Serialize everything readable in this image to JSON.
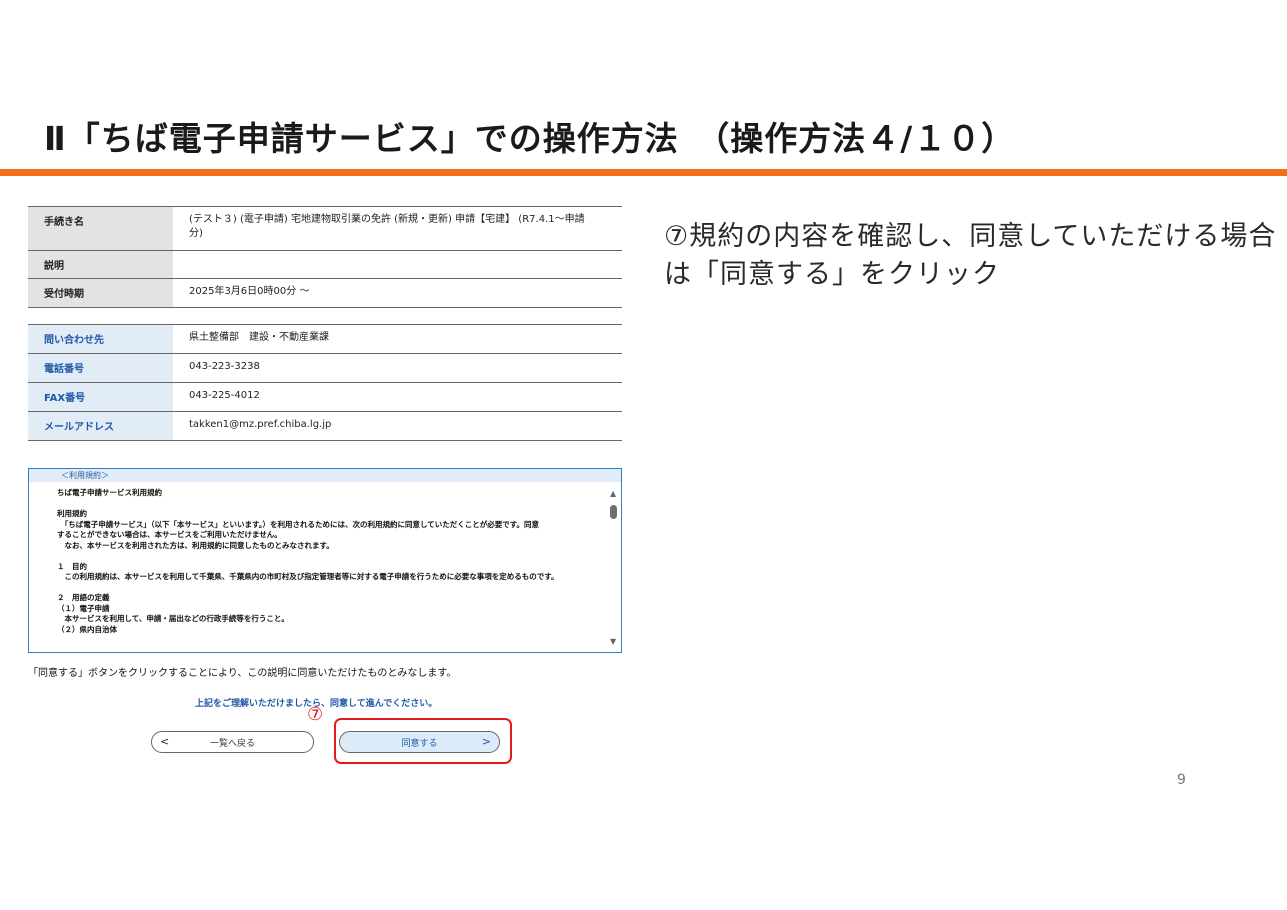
{
  "slide": {
    "title": "Ⅱ「ちば電子申請サービス」での操作方法　（操作方法４/１０）",
    "page_number": "9",
    "accent_color": "#f36f1d"
  },
  "procedure_table": {
    "rows": [
      {
        "label": "手続き名",
        "value": "(テスト３) (電子申請) 宅地建物取引業の免許 (新規・更新) 申請【宅建】 (R7.4.1～申請\n分)"
      },
      {
        "label": "説明",
        "value": ""
      },
      {
        "label": "受付時期",
        "value": "2025年3月6日0時00分 ～"
      }
    ]
  },
  "contact_table": {
    "rows": [
      {
        "label": "問い合わせ先",
        "value": "県土整備部　建設・不動産業課"
      },
      {
        "label": "電話番号",
        "value": "043-223-3238"
      },
      {
        "label": "FAX番号",
        "value": "043-225-4012"
      },
      {
        "label": "メールアドレス",
        "value": "takken1@mz.pref.chiba.lg.jp"
      }
    ]
  },
  "terms": {
    "header": "＜利用規約＞",
    "body": "ちば電子申請サービス利用規約\n\n利用規約\n　「ちば電子申請サービス」（以下「本サービス」といいます。）を利用されるためには、次の利用規約に同意していただくことが必要です。同意\nすることができない場合は、本サービスをご利用いただけません。\n　なお、本サービスを利用された方は、利用規約に同意したものとみなされます。\n\n１　目的\n　この利用規約は、本サービスを利用して千葉県、千葉県内の市町村及び指定管理者等に対する電子申請を行うために必要な事項を定めるものです。\n\n２　用語の定義\n（１）電子申請\n　本サービスを利用して、申請・届出などの行政手続等を行うこと。\n（２）県内自治体"
  },
  "agreement": {
    "note": "「同意する」ボタンをクリックすることにより、この説明に同意いただけたものとみなします。",
    "proceed_message": "上記をご理解いただけましたら、同意して進んでください。",
    "back_button": "一覧へ戻る",
    "agree_button": "同意する",
    "back_arrow": "<",
    "agree_arrow": ">",
    "step_marker": "⑦",
    "highlight_color": "#e31a1a"
  },
  "instruction": {
    "text": "⑦規約の内容を確認し、同意していただける場合は「同意する」をクリック"
  }
}
